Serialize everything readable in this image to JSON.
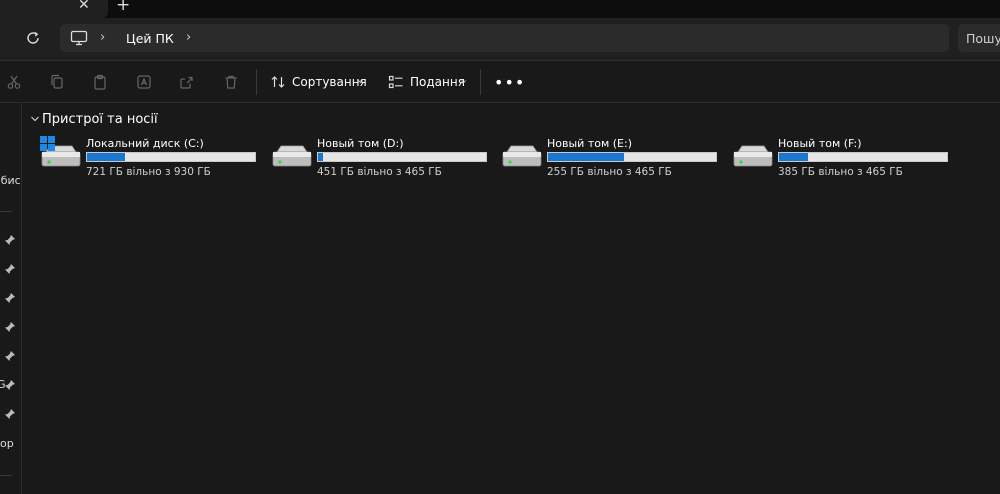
{
  "colors": {
    "accent": "#1a78d2",
    "background": "#191919",
    "bar_bg": "#e6e6e6"
  },
  "tabs": {
    "close_icon": "close-icon",
    "new_tab_label": "+"
  },
  "address": {
    "breadcrumb": "Цей ПК",
    "icon": "monitor-icon"
  },
  "search": {
    "placeholder": "Пошу"
  },
  "toolbar": {
    "sort_label": "Сортування",
    "view_label": "Подання",
    "more_label": "•••",
    "caret": "⌄"
  },
  "sidebar": {
    "text_1": "обис",
    "text_2": "G",
    "text_3": "cop"
  },
  "group": {
    "title": "Пристрої та носії"
  },
  "drives": [
    {
      "name": "Локальний диск (C:)",
      "free": "721 ГБ вільно з 930 ГБ",
      "used_fraction": 0.225,
      "system": true
    },
    {
      "name": "Новый том (D:)",
      "free": "451 ГБ вільно з 465 ГБ",
      "used_fraction": 0.03,
      "system": false
    },
    {
      "name": "Новый том (E:)",
      "free": "255 ГБ вільно з 465 ГБ",
      "used_fraction": 0.452,
      "system": false
    },
    {
      "name": "Новый том (F:)",
      "free": "385 ГБ вільно з 465 ГБ",
      "used_fraction": 0.172,
      "system": false
    }
  ]
}
